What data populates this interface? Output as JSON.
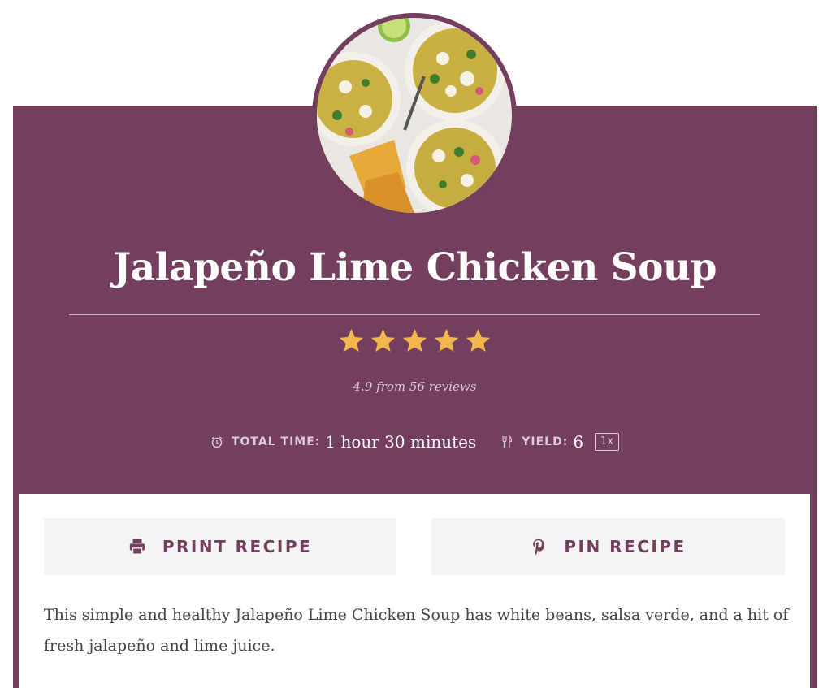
{
  "recipe": {
    "title": "Jalapeño Lime Chicken Soup",
    "rating": {
      "value": 4.9,
      "max": 5,
      "stars_filled": 5,
      "text": "4.9 from 56 reviews"
    },
    "total_time": {
      "label": "TOTAL TIME:",
      "value": "1 hour 30 minutes",
      "icon": "alarm-clock-icon"
    },
    "yield": {
      "label": "YIELD:",
      "value": "6",
      "multiplier": "1x",
      "icon": "fork-knife-icon"
    },
    "summary": "This simple and healthy Jalapeño Lime Chicken Soup has white beans, salsa verde, and a hit of fresh jalapeño and lime juice."
  },
  "buttons": {
    "print": {
      "label": "PRINT RECIPE",
      "icon": "printer-icon"
    },
    "pin": {
      "label": "PIN RECIPE",
      "icon": "pinterest-icon"
    }
  },
  "colors": {
    "brand": "#743e5e",
    "star": "#f2b84b",
    "button_bg": "#f4f4f4",
    "body_text": "#444444"
  }
}
